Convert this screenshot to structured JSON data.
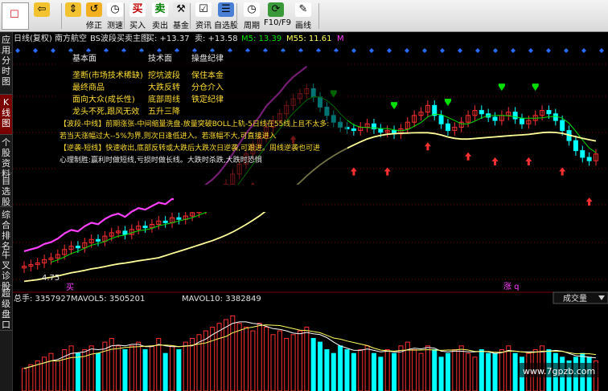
{
  "toolbar": {
    "logo_text": "☐",
    "buttons": [
      {
        "label": "",
        "icon": "back-arrow-icon"
      },
      {
        "label": "",
        "icon": "up-down-icon"
      },
      {
        "label": "修正",
        "icon": "undo-icon"
      },
      {
        "label": "测速",
        "icon": "clock-icon"
      },
      {
        "label": "买入",
        "glyph": "买",
        "color": "#c00000"
      },
      {
        "label": "卖出",
        "glyph": "卖",
        "color": "#008000"
      },
      {
        "label": "基金",
        "icon": "hammer-icon"
      },
      {
        "label": "资讯",
        "icon": "checkbox-icon"
      },
      {
        "label": "自选股",
        "icon": "list-icon"
      },
      {
        "label": "周期",
        "icon": "clock-icon"
      },
      {
        "label": "F10/F9",
        "icon": "refresh-icon"
      },
      {
        "label": "画线",
        "icon": "pen-icon"
      }
    ]
  },
  "sidebar": {
    "tabs": [
      "应用",
      "分时图",
      "K线图",
      "个股资料",
      "自选股",
      "综合排名",
      "牛叉诊股",
      "超级盘口"
    ],
    "active": 2
  },
  "header": {
    "period": "日线(复权)",
    "stock": "南方航空",
    "indicator": "BS波段买卖主图",
    "buy": "买: +13.37",
    "sell": "卖: +13.58",
    "m5": "M5: 13.39",
    "m55": "M55: 11.61",
    "m": "M"
  },
  "legend": {
    "cols": [
      [
        "基本面",
        "垄断(市场技术稀缺)",
        "最终商品",
        "面向大众(成长性)",
        "龙头不死,跟风无效"
      ],
      [
        "技术面",
        "挖坑波段",
        "大跌反转",
        "底部周线",
        "五升三降"
      ],
      [
        "操盘纪律",
        "保住本金",
        "分仓介入",
        "铁定纪律"
      ]
    ]
  },
  "notes": [
    "【波段-中线】前期涨张-中间缩量洗盘-放量突破BOLL上轨-5日线在55线上且不太多:",
    "若当天涨幅过大--5%为界,则次日逢低进入。若涨幅不大,可直接进入",
    "【逆袭-短线】快速收出,底部反转或大跌后大跌次日逆袭,可跟进。周线逆袭也可进",
    "心理制胜:赢利时做短线,亏损时做长线。大跌时杀跌,大跌时恐惧"
  ],
  "price_low_label": "4.75",
  "buy_marker": "买",
  "sell_marker": "涨 q",
  "volume": {
    "total": "总手: 3357927",
    "mavol5": "MAVOL5: 3505201",
    "mavol10": "MAVOL10: 3382849",
    "selector": "成交量"
  },
  "watermark": "www.7gpzb.com",
  "chart_data": {
    "type": "candlestick",
    "series_colors": {
      "up": "#ff3030",
      "down": "#00ffff",
      "ma_fast": "#00e000",
      "ma_slow": "#ffff99",
      "trend": "#ff40ff"
    },
    "note": "",
    "closes": [
      4.9,
      5.0,
      5.1,
      5.3,
      5.4,
      5.6,
      5.9,
      6.1,
      6.0,
      6.3,
      6.5,
      6.4,
      6.7,
      6.9,
      7.0,
      6.8,
      7.1,
      7.3,
      7.2,
      7.4,
      7.6,
      7.5,
      7.8,
      7.7,
      7.9,
      8.1,
      8.3,
      8.6,
      8.9,
      9.3,
      9.8,
      10.4,
      11.0,
      11.6,
      12.1,
      12.6,
      13.2,
      13.6,
      14.0,
      14.5,
      14.9,
      15.2,
      15.5,
      15.0,
      14.4,
      13.9,
      13.5,
      13.2,
      13.1,
      13.0,
      13.2,
      13.4,
      13.1,
      12.9,
      13.0,
      12.8,
      13.1,
      13.5,
      13.9,
      14.1,
      14.5,
      13.9,
      13.4,
      13.0,
      13.2,
      13.5,
      13.9,
      14.2,
      14.0,
      13.8,
      13.6,
      13.9,
      14.1,
      13.7,
      13.4,
      13.6,
      13.9,
      14.2,
      14.0,
      13.6,
      13.0,
      12.4,
      11.8,
      11.4,
      11.2,
      11.6
    ],
    "volumes": [
      0.3,
      0.35,
      0.4,
      0.45,
      0.5,
      0.4,
      0.55,
      0.6,
      0.5,
      0.55,
      0.6,
      0.5,
      0.65,
      0.7,
      0.6,
      0.55,
      0.6,
      0.65,
      0.55,
      0.6,
      0.7,
      0.5,
      0.6,
      0.55,
      0.65,
      0.7,
      0.75,
      0.8,
      0.85,
      0.9,
      0.95,
      1.0,
      0.9,
      0.85,
      0.8,
      0.9,
      0.85,
      0.75,
      0.8,
      0.7,
      0.75,
      0.8,
      0.85,
      0.7,
      0.65,
      0.55,
      0.5,
      0.6,
      0.55,
      0.5,
      0.55,
      0.6,
      0.5,
      0.45,
      0.55,
      0.5,
      0.6,
      0.65,
      0.55,
      0.5,
      0.6,
      0.55,
      0.45,
      0.5,
      0.55,
      0.6,
      0.5,
      0.45,
      0.55,
      0.5,
      0.5,
      0.55,
      0.6,
      0.5,
      0.45,
      0.5,
      0.55,
      0.6,
      0.55,
      0.5,
      0.45,
      0.4,
      0.45,
      0.5,
      0.45,
      0.4
    ],
    "sell_arrow_bars": [
      46,
      55,
      63,
      71,
      76
    ],
    "buy_arrow_bars": [
      34,
      40,
      49,
      54,
      60,
      66,
      70,
      75,
      80,
      84
    ]
  }
}
